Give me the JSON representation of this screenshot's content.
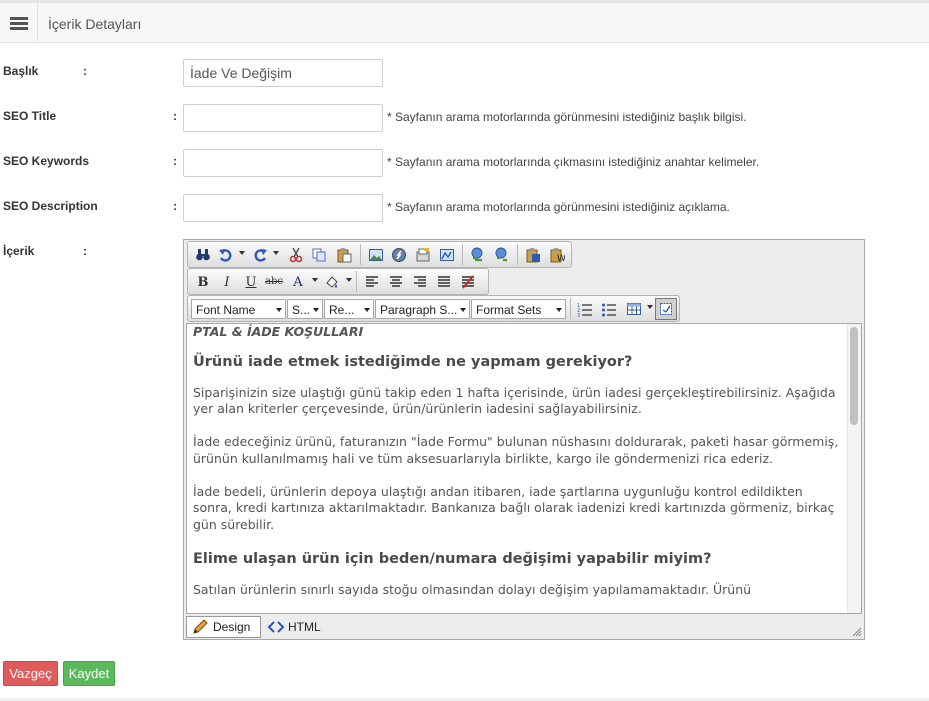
{
  "header": {
    "title": "İçerik Detayları",
    "menu_icon": "hamburger-icon"
  },
  "form": {
    "baslik": {
      "label": "Başlık",
      "colon": ":",
      "value": "İade Ve Değişim"
    },
    "seo_title": {
      "label": "SEO Title",
      "colon": ":",
      "value": "",
      "hint": "* Sayfanın arama motorlarında görünmesini istediğiniz başlık bilgisi."
    },
    "seo_keywords": {
      "label": "SEO Keywords",
      "colon": ":",
      "value": "",
      "hint": "* Sayfanın arama motorlarında çıkmasını istediğiniz anahtar kelimeler."
    },
    "seo_description": {
      "label": "SEO Description",
      "colon": ":",
      "value": "",
      "hint": "* Sayfanın arama motorlarında görünmesini istediğiniz açıklama."
    },
    "icerik": {
      "label": "İçerik",
      "colon": ":"
    }
  },
  "editor": {
    "toolbar1": [
      "find-icon",
      "undo-icon",
      "redo-icon",
      "cut-icon",
      "copy-icon",
      "paste-icon",
      "image-icon",
      "flash-icon",
      "document-properties-icon",
      "image-map-icon",
      "link-icon",
      "unlink-icon",
      "paste-from-word-icon",
      "paste-plain-text-icon"
    ],
    "toolbar2": {
      "bold": "B",
      "italic": "I",
      "underline": "U",
      "strike": "abc",
      "fore_color": "A",
      "icons": [
        "bold-icon",
        "italic-icon",
        "underline-icon",
        "strikethrough-icon",
        "font-color-icon",
        "highlight-color-icon",
        "align-left-icon",
        "align-center-icon",
        "align-right-icon",
        "justify-icon",
        "remove-format-icon"
      ]
    },
    "toolbar3": {
      "font_name": "Font Name",
      "font_size": "S...",
      "real_font_size": "Re...",
      "paragraph_style": "Paragraph S...",
      "format_sets": "Format Sets",
      "icons": [
        "ordered-list-icon",
        "bulleted-list-icon",
        "table-icon",
        "toggle-border-icon"
      ]
    },
    "content": {
      "lead": "PTAL & İADE KOŞULLARI",
      "h1": "Ürünü iade etmek istediğimde ne yapmam gerekiyor?",
      "p1": "Siparişinizin size ulaştığı günü takip eden 1 hafta içerisinde, ürün iadesi gerçekleştirebilirsiniz. Aşağıda yer alan kriterler çerçevesinde, ürün/ürünlerin iadesini sağlayabilirsiniz.",
      "p2": "İade edeceğiniz ürünü, faturanızın \"İade Formu\" bulunan nüshasını doldurarak, paketi hasar görmemiş, ürünün kullanılmamış hali ve tüm aksesuarlarıyla birlikte, kargo ile göndermenizi rica ederiz.",
      "p3": "İade bedeli, ürünlerin depoya ulaştığı andan itibaren, iade şartlarına uygunluğu kontrol edildikten sonra, kredi kartınıza aktarılmaktadır. Bankanıza bağlı olarak iadenizi kredi kartınızda görmeniz, birkaç gün sürebilir.",
      "h2": "Elime ulaşan ürün için beden/numara değişimi yapabilir miyim?",
      "p4": "Satılan ürünlerin sınırlı sayıda stoğu olmasından dolayı değişim yapılamamaktadır. Ürünü"
    },
    "modes": {
      "design": "Design",
      "html": "HTML"
    }
  },
  "actions": {
    "cancel": "Vazgeç",
    "save": "Kaydet"
  },
  "colors": {
    "cancel": "#e05b5b",
    "save": "#5cb85c",
    "header_bg": "#f7f7f7"
  }
}
